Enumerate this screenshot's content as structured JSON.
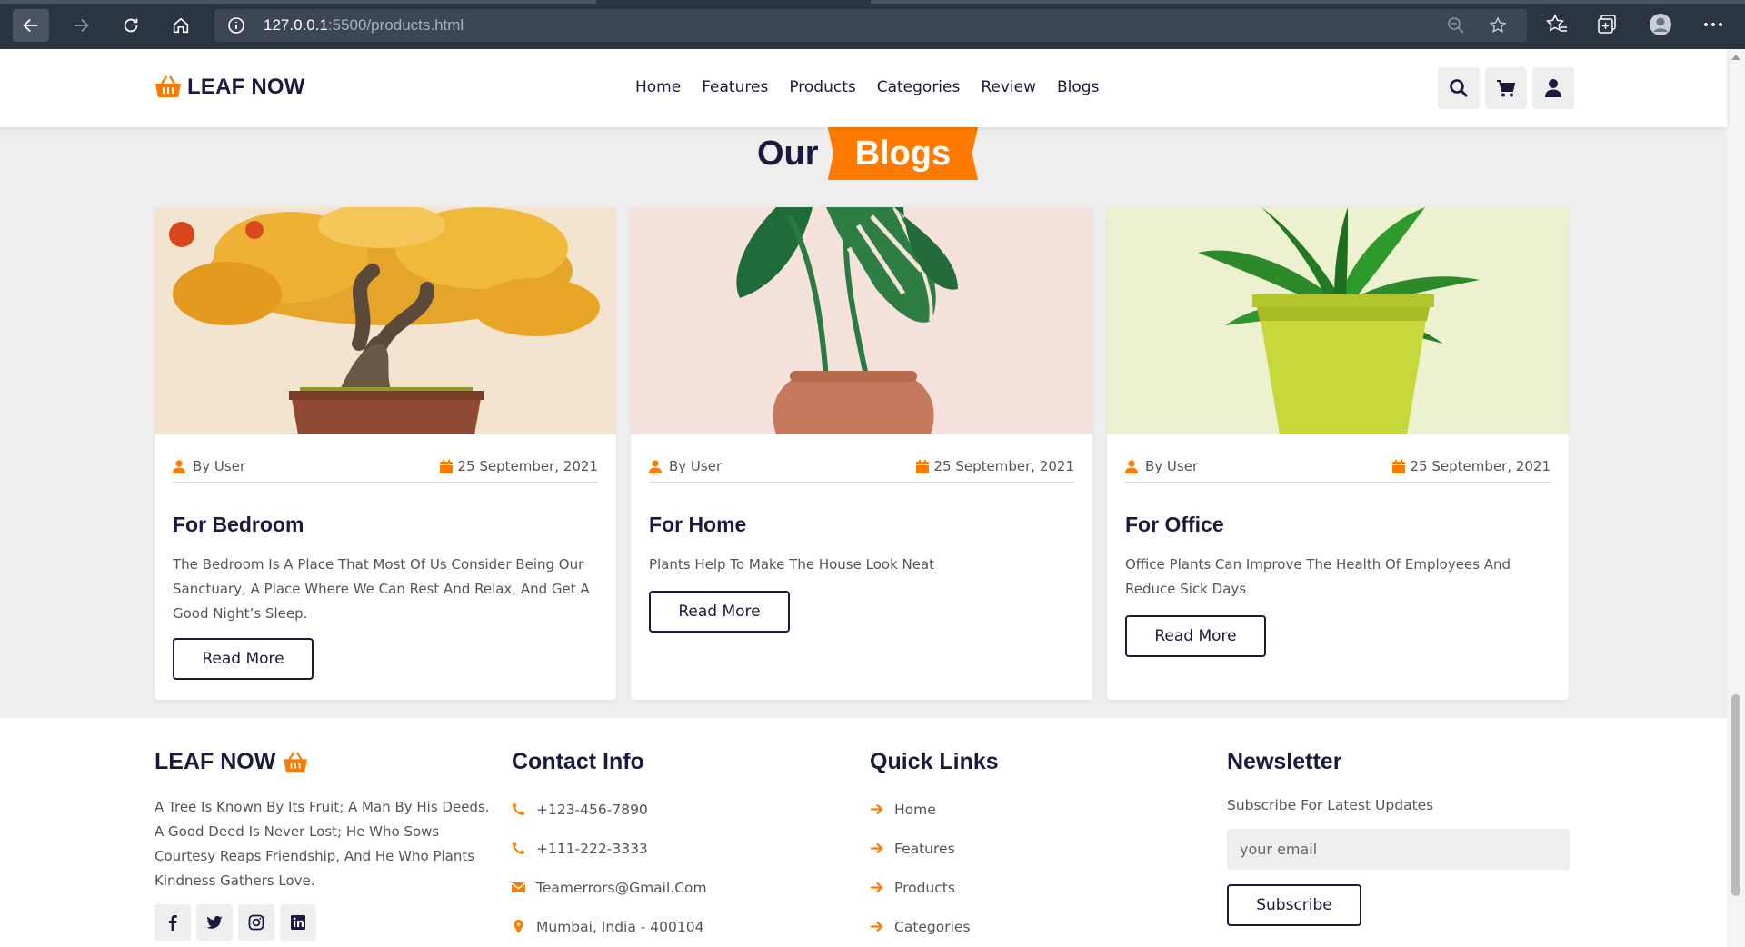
{
  "browser": {
    "url_host": "127.0.0.1",
    "url_path": ":5500/products.html"
  },
  "header": {
    "brand": "LEAF NOW",
    "nav": [
      "Home",
      "Features",
      "Products",
      "Categories",
      "Review",
      "Blogs"
    ]
  },
  "blogs": {
    "heading_first": "Our",
    "heading_highlight": "Blogs",
    "read_more": "Read More",
    "cards": [
      {
        "author": "By User",
        "date": "25 September, 2021",
        "title": "For Bedroom",
        "desc": "The Bedroom Is A Place That Most Of Us Consider Being Our Sanctuary, A Place Where We Can Rest And Relax, And Get A Good Night’s Sleep."
      },
      {
        "author": "By User",
        "date": "25 September, 2021",
        "title": "For Home",
        "desc": "Plants Help To Make The House Look Neat"
      },
      {
        "author": "By User",
        "date": "25 September, 2021",
        "title": "For Office",
        "desc": "Office Plants Can Improve The Health Of Employees And Reduce Sick Days"
      }
    ]
  },
  "footer": {
    "brand": "LEAF NOW",
    "about": "A Tree Is Known By Its Fruit; A Man By His Deeds. A Good Deed Is Never Lost; He Who Sows Courtesy Reaps Friendship, And He Who Plants Kindness Gathers Love.",
    "contact_title": "Contact Info",
    "contacts": [
      "+123-456-7890",
      "+111-222-3333",
      "Teamerrors@Gmail.Com",
      "Mumbai, India - 400104"
    ],
    "links_title": "Quick Links",
    "links": [
      "Home",
      "Features",
      "Products",
      "Categories"
    ],
    "newsletter_title": "Newsletter",
    "newsletter_sub": "Subscribe For Latest Updates",
    "email_placeholder": "your email",
    "subscribe_label": "Subscribe"
  },
  "colors": {
    "accent": "#ff7a00",
    "navy": "#1a1a3e",
    "page_bg": "#eeeeee"
  }
}
